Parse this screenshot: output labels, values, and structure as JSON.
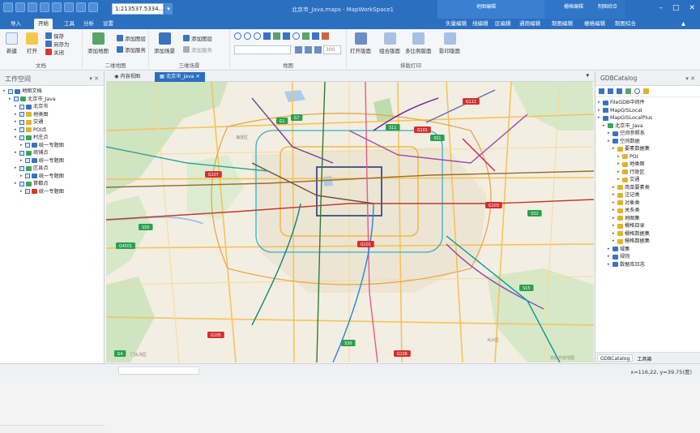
{
  "titlebar": {
    "scale_value": "1:213537.5334...",
    "window_title": "北京市_Java.maps - MapWorkSpace1",
    "context_groups": [
      "地图编辑",
      "栅格编辑",
      "制图综合"
    ],
    "context_tabs": [
      "矢量编辑",
      "线编辑",
      "区编辑",
      "通用编辑",
      "制图编辑",
      "栅格编辑",
      "制图综合"
    ]
  },
  "tabs": [
    "导入",
    "开始",
    "工具",
    "分析",
    "设置"
  ],
  "active_tab": "开始",
  "ribbon": {
    "doc": {
      "label": "文档",
      "new": "新建",
      "open": "打开",
      "save": "保存",
      "saveas": "另存为",
      "close": "关闭"
    },
    "map2d": {
      "label": "二维地图",
      "add_map": "添加地图",
      "add_layer": "添加图层",
      "add_service": "添加服务"
    },
    "scene3d": {
      "label": "三维场景",
      "add_scene": "添加场景",
      "add_layer": "添加图层",
      "add_service": "添加服务"
    },
    "map": {
      "label": "地图",
      "zoom_value": "300"
    },
    "print": {
      "label": "排版打印",
      "open_layout": "打开版面",
      "fixed_layout": "组合版面",
      "multi_layout": "多比例版面",
      "print_view": "影印版面"
    }
  },
  "left_panel": {
    "title": "工作空间",
    "tree": [
      {
        "label": "地图文档",
        "level": 0,
        "icon": "#3a73c2"
      },
      {
        "label": "北京市_Java",
        "level": 1,
        "icon": "#3aa657"
      },
      {
        "label": "北京市",
        "level": 2,
        "icon": "#3a73c2"
      },
      {
        "label": "地类图",
        "level": 2,
        "icon": "#e0b22d"
      },
      {
        "label": "交通",
        "level": 2,
        "icon": "#e0b22d"
      },
      {
        "label": "POI点",
        "level": 2,
        "icon": "#e0b22d"
      },
      {
        "label": "村庄点",
        "level": 2,
        "icon": "#3aa657"
      },
      {
        "label": "统一专题图",
        "level": 3,
        "icon": "#3a73c2"
      },
      {
        "label": "商铺点",
        "level": 2,
        "icon": "#3aa657"
      },
      {
        "label": "统一专题图",
        "level": 3,
        "icon": "#3a73c2"
      },
      {
        "label": "区县点",
        "level": 2,
        "icon": "#3aa657"
      },
      {
        "label": "统一专题图",
        "level": 3,
        "icon": "#3a73c2"
      },
      {
        "label": "首都点",
        "level": 2,
        "icon": "#3aa657"
      },
      {
        "label": "统一专题图",
        "level": 3,
        "icon": "#d33"
      }
    ]
  },
  "doc_tabs": [
    "内容视图",
    "北京市_Java"
  ],
  "map": {
    "watermark": "高德开放地图",
    "district_1": "海淀区",
    "district_2": "门头沟区",
    "district_3": "大兴区",
    "badges": [
      {
        "t": "G111",
        "c": "#d32f2f"
      },
      {
        "t": "G7",
        "c": "#2e9e4f"
      },
      {
        "t": "G1",
        "c": "#2e9e4f"
      },
      {
        "t": "S11",
        "c": "#2e9e4f"
      },
      {
        "t": "G101",
        "c": "#d32f2f"
      },
      {
        "t": "S51",
        "c": "#2e9e4f"
      },
      {
        "t": "G107",
        "c": "#d32f2f"
      },
      {
        "t": "S50",
        "c": "#2e9e4f"
      },
      {
        "t": "G103",
        "c": "#d32f2f"
      },
      {
        "t": "S32",
        "c": "#2e9e4f"
      },
      {
        "t": "G4501",
        "c": "#2e9e4f"
      },
      {
        "t": "G105",
        "c": "#d32f2f"
      },
      {
        "t": "S15",
        "c": "#2e9e4f"
      },
      {
        "t": "G4",
        "c": "#2e9e4f"
      },
      {
        "t": "S30",
        "c": "#2e9e4f"
      },
      {
        "t": "G106",
        "c": "#d32f2f"
      },
      {
        "t": "G101",
        "c": "#d32f2f"
      }
    ]
  },
  "right_panel": {
    "title": "GDBCatalog",
    "tree": [
      {
        "label": "FileGDB中间件",
        "level": 0
      },
      {
        "label": "MapGISLocal",
        "level": 0
      },
      {
        "label": "MapGISLocalPlus",
        "level": 0
      },
      {
        "label": "北京市_Java",
        "level": 1
      },
      {
        "label": "空间参照系",
        "level": 2
      },
      {
        "label": "空间数据",
        "level": 2
      },
      {
        "label": "要素数据集",
        "level": 3
      },
      {
        "label": "POI",
        "level": 4
      },
      {
        "label": "地类图",
        "level": 4
      },
      {
        "label": "行政区",
        "level": 4
      },
      {
        "label": "交通",
        "level": 4
      },
      {
        "label": "简单要素类",
        "level": 3
      },
      {
        "label": "注记类",
        "level": 3
      },
      {
        "label": "对象类",
        "level": 3
      },
      {
        "label": "关系类",
        "level": 3
      },
      {
        "label": "地图集",
        "level": 3
      },
      {
        "label": "栅格目录",
        "level": 3
      },
      {
        "label": "栅格数据集",
        "level": 3
      },
      {
        "label": "栅格数据集",
        "level": 3
      },
      {
        "label": "域集",
        "level": 2
      },
      {
        "label": "规则",
        "level": 2
      },
      {
        "label": "数据库日志",
        "level": 2
      }
    ],
    "bottom_tabs": [
      "GDBCatalog",
      "工具箱"
    ]
  },
  "status": {
    "coord": "x=116.22, y=39.75(度)"
  }
}
